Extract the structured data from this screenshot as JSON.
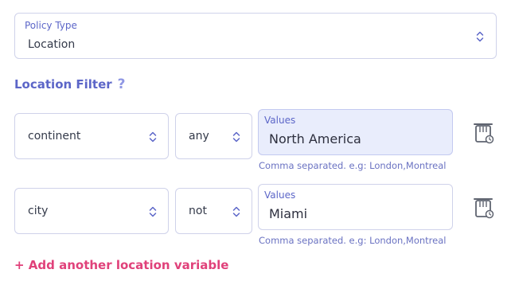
{
  "policy": {
    "label": "Policy Type",
    "value": "Location"
  },
  "section": {
    "title": "Location Filter",
    "help_glyph": "?"
  },
  "rows": [
    {
      "variable": "continent",
      "operator": "any",
      "values_label": "Values",
      "values": "North America",
      "hint": "Comma separated. e.g: London,Montreal",
      "active": true
    },
    {
      "variable": "city",
      "operator": "not",
      "values_label": "Values",
      "values": "Miami",
      "hint": "Comma separated. e.g: London,Montreal",
      "active": false
    }
  ],
  "add_label": "+ Add another location variable",
  "colors": {
    "accent": "#5c66c8",
    "link": "#e0417a",
    "border": "#cfd2ea",
    "active_bg": "#e9edfc",
    "icon": "#6b7280"
  },
  "icons": {
    "select": "chevron-updown-icon",
    "delete": "trash-icon",
    "help": "help-icon"
  }
}
